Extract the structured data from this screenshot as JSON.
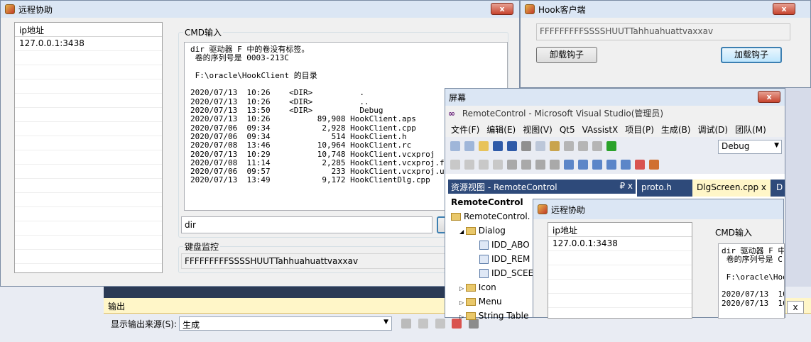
{
  "remote_window": {
    "title": "远程协助",
    "close_label": "x",
    "list_header": "ip地址",
    "list_items": [
      "127.0.0.1:3438"
    ],
    "cmd_group_label": "CMD输入",
    "cmd_output": "dir 驱动器 F 中的卷没有标签。\n 卷的序列号是 0003-213C\n\n F:\\oracle\\HookClient 的目录\n\n2020/07/13  10:26    <DIR>          .\n2020/07/13  10:26    <DIR>          ..\n2020/07/13  13:50    <DIR>          Debug\n2020/07/13  10:26          89,908 HookClient.aps\n2020/07/06  09:34           2,928 HookClient.cpp\n2020/07/06  09:34             514 HookClient.h\n2020/07/08  13:46          10,964 HookClient.rc\n2020/07/13  10:29          10,748 HookClient.vcxproj\n2020/07/08  11:14           2,285 HookClient.vcxproj.filters\n2020/07/06  09:57             233 HookClient.vcxproj.user\n2020/07/13  13:49           9,172 HookClientDlg.cpp",
    "cmd_input_value": "dir",
    "kbd_group_label": "键盘监控",
    "kbd_value": "FFFFFFFFFSSSSHUUTTahhuahuattvaxxav"
  },
  "hook_window": {
    "title": "Hook客户端",
    "close_label": "x",
    "value": "FFFFFFFFFSSSSHUUTTahhuahuattvaxxav",
    "unload_label": "卸载钩子",
    "load_label": "加载钩子"
  },
  "screen_window": {
    "title": "屏幕",
    "close_label": "x"
  },
  "vs": {
    "title": "RemoteControl - Microsoft Visual Studio(管理员)",
    "menu": [
      "文件(F)",
      "编辑(E)",
      "视图(V)",
      "Qt5",
      "VAssistX",
      "项目(P)",
      "生成(B)",
      "调试(D)",
      "团队(M)"
    ],
    "config_value": "Debug",
    "resource_panel_title": "资源视图 - RemoteControl",
    "panel_pin": "₽ x",
    "tabs": [
      "proto.h",
      "DlgScreen.cpp",
      "D"
    ],
    "tree": {
      "root": "RemoteControl",
      "project": "RemoteControl.",
      "dialog": "Dialog",
      "items": [
        "IDD_ABO",
        "IDD_REM",
        "IDD_SCEE"
      ],
      "icon": "Icon",
      "menu": "Menu",
      "string_table": "String Table"
    }
  },
  "inner_window": {
    "title": "远程协助",
    "list_header": "ip地址",
    "list_items": [
      "127.0.0.1:3438"
    ],
    "cmd_group_label": "CMD输入",
    "cmd_output": "dir 驱动器 F 中的\n 卷的序列号是 C\n\n F:\\oracle\\Hook\n\n2020/07/13  10\n2020/07/13  10"
  },
  "output_panel": {
    "title": "输出",
    "source_label": "显示输出来源(S):",
    "source_value": "生成",
    "close_label": "x",
    "stub_label": "   "
  }
}
